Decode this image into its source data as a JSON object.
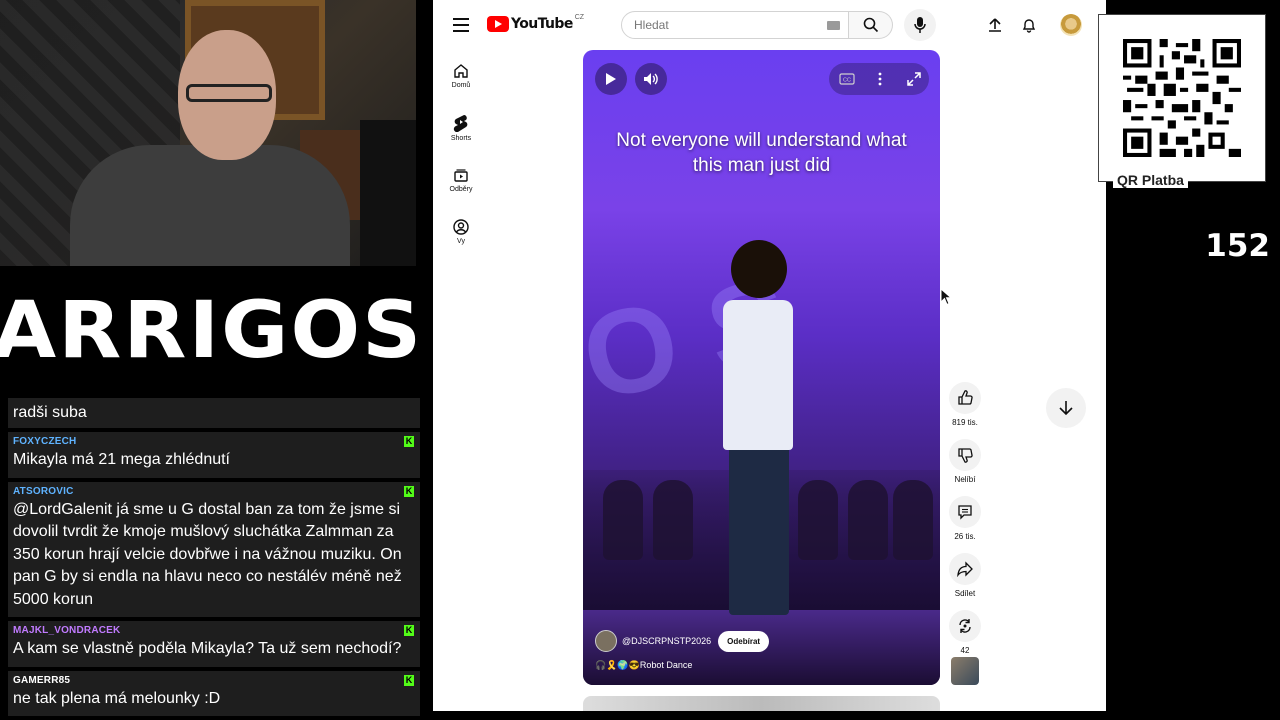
{
  "stream": {
    "logo_text": "ARRIGOS",
    "counter": "152",
    "qr_label": "QR Platba"
  },
  "chat": {
    "messages": [
      {
        "user": "",
        "text": "radši suba",
        "user_color": "#53a7ff",
        "badge": false
      },
      {
        "user": "FOXYCZECH",
        "text": "Mikayla má 21 mega zhlédnutí",
        "user_color": "#5fb3ff",
        "badge": true
      },
      {
        "user": "ATSOROVIC",
        "text": "@LordGalenit já sme u G dostal ban za tom že jsme si dovolil tvrdit že kmoje mušlový sluchátka Zalmman za 350 korun hrají velcie dovbřwe i na vážnou muziku. On pan G by si endla na hlavu neco co nestálév méně než 5000 korun",
        "user_color": "#5fb3ff",
        "badge": true
      },
      {
        "user": "MAJKL_VONDRACEK",
        "text": "A kam se vlastně poděla Mikayla? Ta už sem nechodí?",
        "user_color": "#c17bff",
        "badge": true
      },
      {
        "user": "GAMERR85",
        "text": "ne tak plena má melounky :D",
        "user_color": "#ffffff",
        "badge": true
      }
    ],
    "badge_glyph": "K"
  },
  "youtube": {
    "logo_word": "YouTube",
    "logo_country": "CZ",
    "search": {
      "placeholder": "Hledat"
    },
    "nav": [
      {
        "label": "Domů",
        "icon": "home-icon"
      },
      {
        "label": "Shorts",
        "icon": "shorts-icon"
      },
      {
        "label": "Odběry",
        "icon": "subscriptions-icon"
      },
      {
        "label": "Vy",
        "icon": "you-icon"
      }
    ],
    "video": {
      "caption": "Not everyone will understand what this man just did",
      "channel": "@DJSCRPNSTP2026",
      "subscribe_label": "Odebírat",
      "song": "🎧🎗️🌍😎Robot Dance"
    },
    "actions": {
      "likes": "819 tis.",
      "dislike_label": "Nelíbí",
      "comments": "26 tis.",
      "share_label": "Sdílet",
      "remix": "42"
    }
  }
}
